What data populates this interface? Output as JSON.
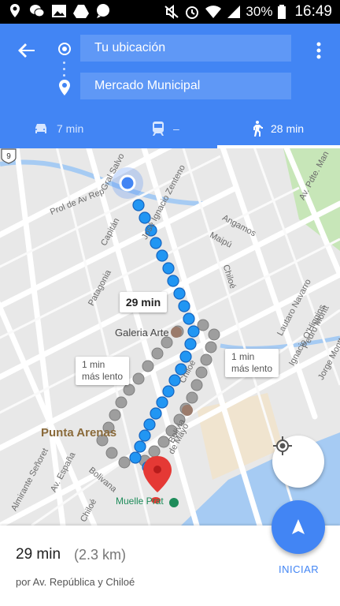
{
  "status_bar": {
    "battery": "30%",
    "time": "16:49"
  },
  "header": {
    "origin": "Tu ubicación",
    "destination": "Mercado Municipal",
    "modes": [
      {
        "name": "drive",
        "time": "7 min",
        "icon": "car-icon"
      },
      {
        "name": "transit",
        "time": "–",
        "icon": "train-icon"
      },
      {
        "name": "walk",
        "time": "28 min",
        "icon": "walk-icon",
        "selected": true
      }
    ]
  },
  "map": {
    "route_bubble": "29 min",
    "alt_left": [
      "1 min",
      "más lento"
    ],
    "alt_right": [
      "1 min",
      "más lento"
    ],
    "place_labels": {
      "galeria": "Galeria Arte",
      "punta_arenas": "Punta Arenas",
      "muelle": "Muelle Prat",
      "route_number": "9"
    },
    "street_labels": [
      "Gral Salvo",
      "José Ignacio Zenteno",
      "Capitán",
      "Prol de Av Rep",
      "Angamos",
      "Maipú",
      "Chiloé",
      "Patagonia",
      "Lautaro Navarro",
      "Pedro Montt",
      "Ignacio O'Higgins",
      "Jorge Montt",
      "Av. Pdte. Man",
      "Chiloé",
      "de Mayo",
      "Bolivia",
      "Av. España",
      "Almirante Señoret",
      "Bolivana",
      "Chiloé"
    ],
    "colors": {
      "route": "#2196f3",
      "route_alt": "#9e9e9e",
      "water": "#a6cbf3",
      "park": "#c7e6b8",
      "pin": "#e53935"
    }
  },
  "bottom": {
    "eta": "29 min",
    "distance": "(2.3 km)",
    "via": "por Av. República y Chiloé",
    "start_label": "INICIAR"
  }
}
